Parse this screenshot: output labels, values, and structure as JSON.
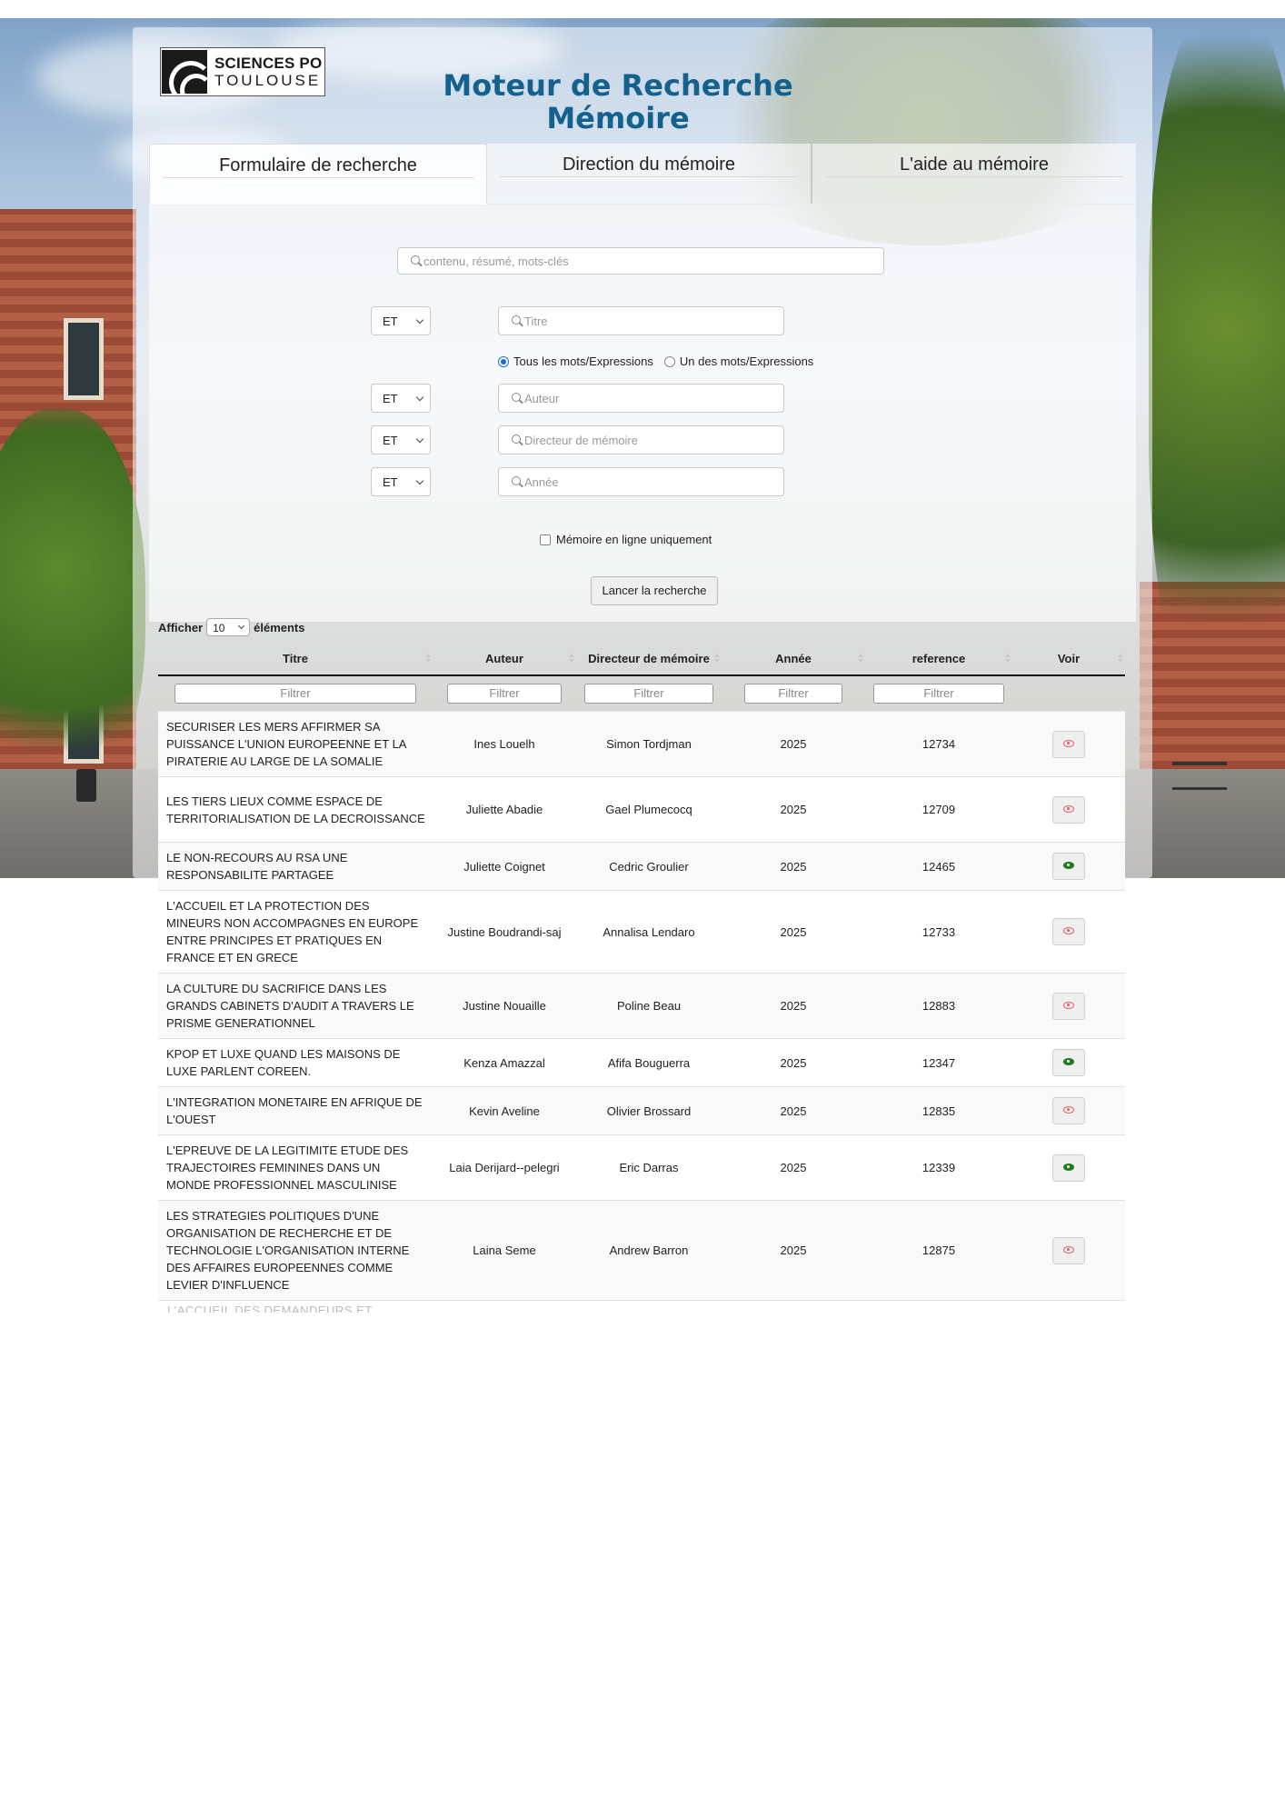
{
  "header": {
    "logo_line1": "SCIENCES PO",
    "logo_line2": "TOULOUSE",
    "title_line1": "Moteur de Recherche",
    "title_line2": "Mémoire"
  },
  "tabs": [
    {
      "label": "Formulaire de recherche",
      "active": true
    },
    {
      "label": "Direction du mémoire",
      "active": false
    },
    {
      "label": "L'aide au mémoire",
      "active": false
    }
  ],
  "form": {
    "main_search_placeholder": "contenu, résumé, mots-clés",
    "operator_value": "ET",
    "title_placeholder": "Titre",
    "author_placeholder": "Auteur",
    "director_placeholder": "Directeur de mémoire",
    "year_placeholder": "Année",
    "radio_all": "Tous les mots/Expressions",
    "radio_any": "Un des mots/Expressions",
    "radio_selected": "all",
    "online_only_label": "Mémoire en ligne uniquement",
    "online_only_checked": false,
    "submit_label": "Lancer la recherche"
  },
  "table": {
    "length_prefix": "Afficher",
    "length_value": "10",
    "length_suffix": "éléments",
    "columns": [
      "Titre",
      "Auteur",
      "Directeur de mémoire",
      "Année",
      "reference",
      "Voir"
    ],
    "filter_placeholder": "Filtrer",
    "rows": [
      {
        "titre": "SECURISER LES MERS AFFIRMER SA PUISSANCE L'UNION EUROPEENNE ET LA PIRATERIE AU LARGE DE LA SOMALIE",
        "auteur": "Ines Louelh",
        "directeur": "Simon Tordjman",
        "annee": "2025",
        "reference": "12734",
        "online": false
      },
      {
        "titre": "LES TIERS LIEUX COMME ESPACE DE TERRITORIALISATION DE LA DECROISSANCE",
        "auteur": "Juliette Abadie",
        "directeur": "Gael Plumecocq",
        "annee": "2025",
        "reference": "12709",
        "online": false
      },
      {
        "titre": "LE NON-RECOURS AU RSA UNE RESPONSABILITE PARTAGEE",
        "auteur": "Juliette Coignet",
        "directeur": "Cedric Groulier",
        "annee": "2025",
        "reference": "12465",
        "online": true
      },
      {
        "titre": "L'ACCUEIL ET LA PROTECTION DES MINEURS NON ACCOMPAGNES EN EUROPE ENTRE PRINCIPES ET PRATIQUES EN FRANCE ET EN GRECE",
        "auteur": "Justine Boudrandi-saj",
        "directeur": "Annalisa Lendaro",
        "annee": "2025",
        "reference": "12733",
        "online": false
      },
      {
        "titre": "LA CULTURE DU SACRIFICE DANS LES GRANDS CABINETS D'AUDIT A TRAVERS LE PRISME GENERATIONNEL",
        "auteur": "Justine Nouaille",
        "directeur": "Poline Beau",
        "annee": "2025",
        "reference": "12883",
        "online": false
      },
      {
        "titre": "KPOP ET LUXE QUAND LES MAISONS DE LUXE PARLENT COREEN.",
        "auteur": "Kenza Amazzal",
        "directeur": "Afifa Bouguerra",
        "annee": "2025",
        "reference": "12347",
        "online": true
      },
      {
        "titre": "L'INTEGRATION MONETAIRE EN AFRIQUE DE L'OUEST",
        "auteur": "Kevin Aveline",
        "directeur": "Olivier Brossard",
        "annee": "2025",
        "reference": "12835",
        "online": false
      },
      {
        "titre": "L'EPREUVE DE LA LEGITIMITE ETUDE DES TRAJECTOIRES FEMININES DANS UN MONDE PROFESSIONNEL MASCULINISE",
        "auteur": "Laia Derijard--pelegri",
        "directeur": "Eric Darras",
        "annee": "2025",
        "reference": "12339",
        "online": true
      },
      {
        "titre": "LES STRATEGIES POLITIQUES D'UNE ORGANISATION DE RECHERCHE ET DE TECHNOLOGIE L'ORGANISATION INTERNE DES AFFAIRES EUROPEENNES COMME LEVIER D'INFLUENCE",
        "auteur": "Laina Seme",
        "directeur": "Andrew Barron",
        "annee": "2025",
        "reference": "12875",
        "online": false
      }
    ],
    "partial_row_text": "L'ACCUEIL DES DEMANDEURS ET"
  },
  "colors": {
    "title": "#14618e",
    "eye_offline": "#e06060",
    "eye_online": "#1f7a1f"
  }
}
